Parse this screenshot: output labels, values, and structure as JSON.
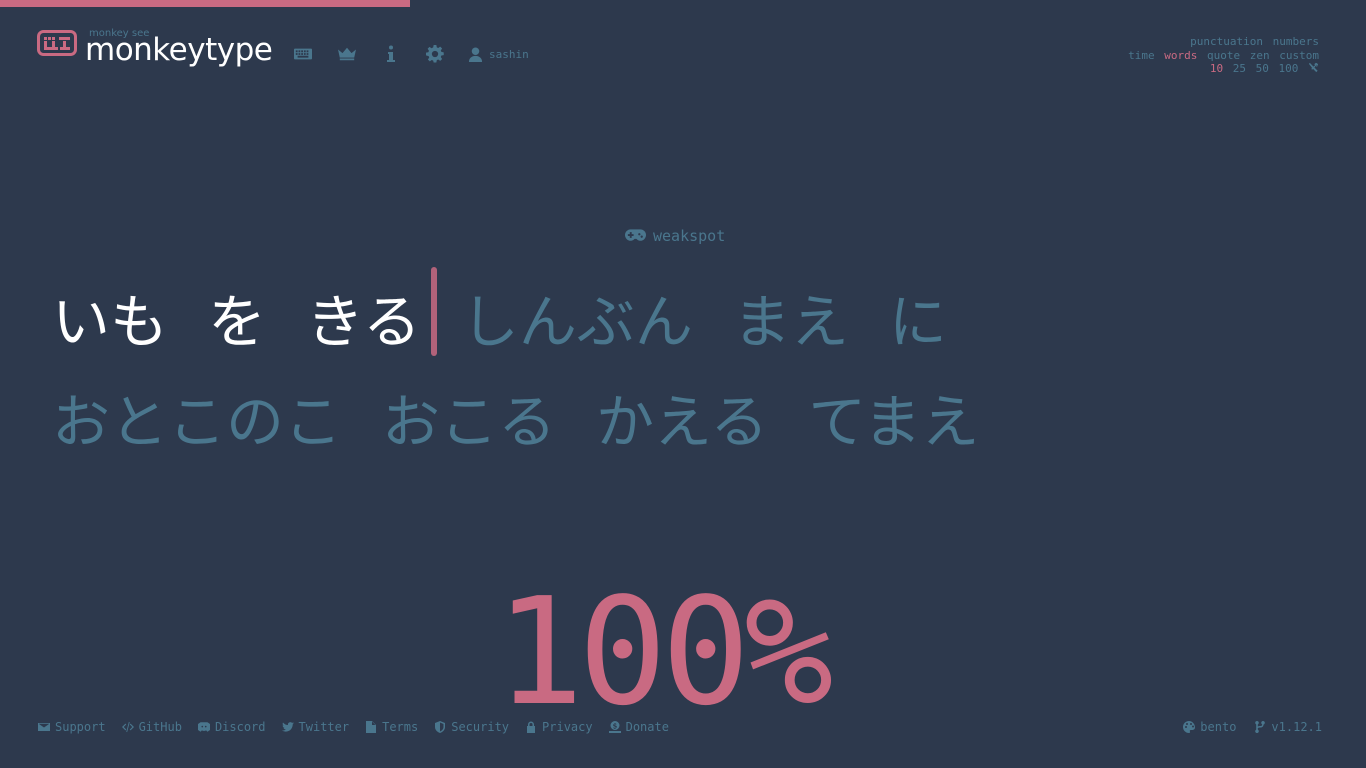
{
  "progress": 0.3,
  "colors": {
    "background": "#2d394d",
    "accent": "#c96a82",
    "text": "#ffffff",
    "sub": "#4a768d"
  },
  "header": {
    "brand_sub": "monkey see",
    "brand_title": "monkeytype",
    "nav_icons": [
      "keyboard-icon",
      "crown-icon",
      "info-icon",
      "gear-icon"
    ],
    "account_name": "sashin"
  },
  "config": {
    "row1": [
      "punctuation",
      "numbers"
    ],
    "row2": [
      "time",
      "words",
      "quote",
      "zen",
      "custom"
    ],
    "row2_active": "words",
    "row3": [
      "10",
      "25",
      "50",
      "100"
    ],
    "row3_active": "10"
  },
  "test": {
    "mode_label": "weakspot",
    "mode_icon": "gamepad-icon",
    "line1_typed": [
      "いも",
      "を",
      "きる"
    ],
    "line1_untyped": [
      "しんぶん",
      "まえ",
      "に"
    ],
    "line2": [
      "おとこのこ",
      "おこる",
      "かえる",
      "てまえ"
    ],
    "progress_text": "100%"
  },
  "footer": {
    "links": [
      {
        "label": "Support",
        "icon": "envelope-icon"
      },
      {
        "label": "GitHub",
        "icon": "code-icon"
      },
      {
        "label": "Discord",
        "icon": "discord-icon"
      },
      {
        "label": "Twitter",
        "icon": "twitter-icon"
      },
      {
        "label": "Terms",
        "icon": "document-icon"
      },
      {
        "label": "Security",
        "icon": "shield-icon"
      },
      {
        "label": "Privacy",
        "icon": "lock-icon"
      },
      {
        "label": "Donate",
        "icon": "donate-icon"
      }
    ],
    "theme": "bento",
    "version": "v1.12.1"
  }
}
